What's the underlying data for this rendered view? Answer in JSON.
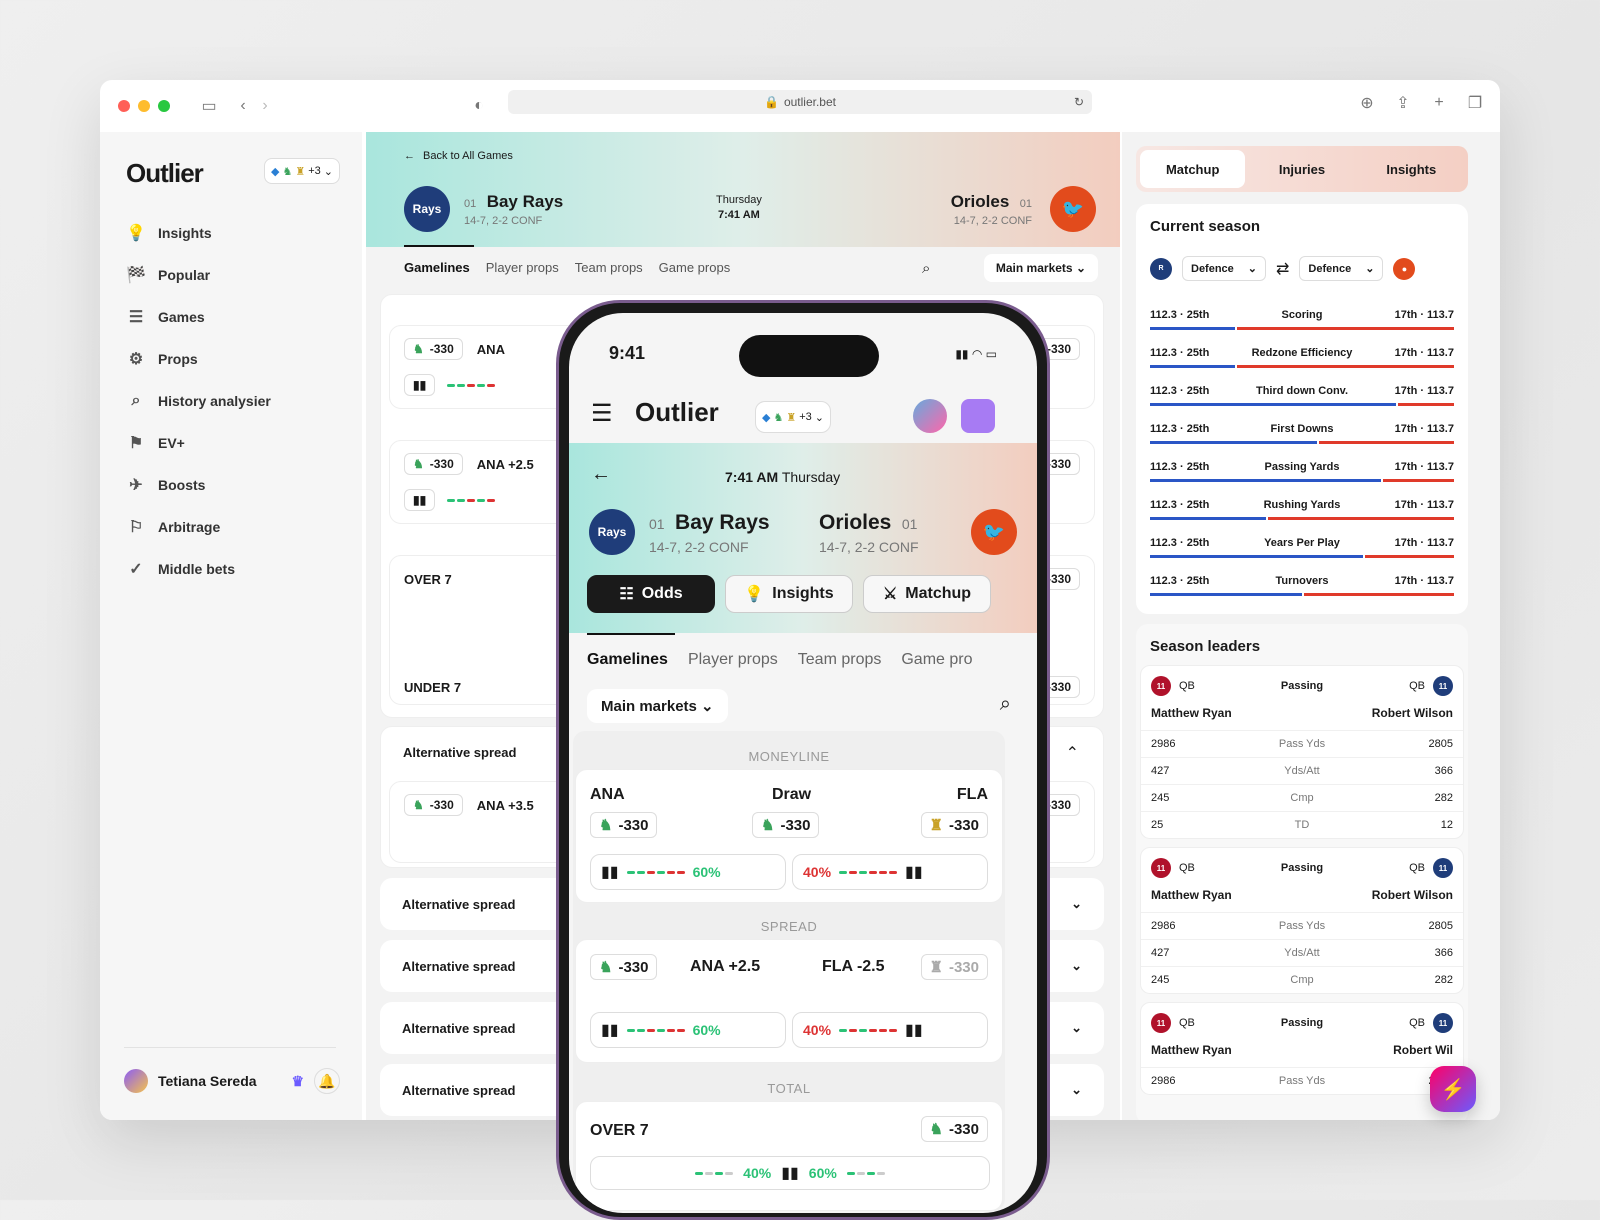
{
  "browser": {
    "url": "outlier.bet"
  },
  "app": {
    "logo": "Outlier",
    "chip_more": "+3"
  },
  "sidebar": {
    "items": [
      {
        "label": "Insights",
        "icon": "lightbulb-icon"
      },
      {
        "label": "Popular",
        "icon": "flame-icon"
      },
      {
        "label": "Games",
        "icon": "stack-icon"
      },
      {
        "label": "Props",
        "icon": "props-icon"
      },
      {
        "label": "History analysier",
        "icon": "history-icon"
      },
      {
        "label": "EV+",
        "icon": "ev-icon"
      },
      {
        "label": "Boosts",
        "icon": "rocket-icon"
      },
      {
        "label": "Arbitrage",
        "icon": "arbitrage-icon"
      },
      {
        "label": "Middle bets",
        "icon": "middle-icon"
      }
    ],
    "user": "Tetiana Sereda"
  },
  "game": {
    "back": "Back to All Games",
    "home": {
      "seed": "01",
      "name": "Bay Rays",
      "record": "14-7, 2-2 CONF",
      "logo": "Rays"
    },
    "away": {
      "seed": "01",
      "name": "Orioles",
      "record": "14-7, 2-2 CONF"
    },
    "day": "Thursday",
    "time": "7:41 AM"
  },
  "tabs": [
    "Gamelines",
    "Player props",
    "Team props",
    "Game props"
  ],
  "main_markets": "Main markets",
  "desktop_cards": {
    "odds": "-330",
    "ana": "ANA",
    "ana_spread": "ANA +2.5",
    "ana_spread2": "ANA +3.5",
    "over": "OVER 7",
    "under": "UNDER 7",
    "alt": "Alternative spread"
  },
  "right": {
    "tabs": [
      "Matchup",
      "Injuries",
      "Insights"
    ],
    "current_season": "Current season",
    "defence": "Defence",
    "stats": [
      {
        "label": "Scoring",
        "l": "112.3 · 25th",
        "r": "17th · 113.7",
        "p": 0.28
      },
      {
        "label": "Redzone Efficiency",
        "l": "112.3 · 25th",
        "r": "17th · 113.7",
        "p": 0.28
      },
      {
        "label": "Third down Conv.",
        "l": "112.3 · 25th",
        "r": "17th · 113.7",
        "p": 0.81
      },
      {
        "label": "First Downs",
        "l": "112.3 · 25th",
        "r": "17th · 113.7",
        "p": 0.55
      },
      {
        "label": "Passing Yards",
        "l": "112.3 · 25th",
        "r": "17th · 113.7",
        "p": 0.76
      },
      {
        "label": "Rushing Yards",
        "l": "112.3 · 25th",
        "r": "17th · 113.7",
        "p": 0.38
      },
      {
        "label": "Years Per Play",
        "l": "112.3 · 25th",
        "r": "17th · 113.7",
        "p": 0.7
      },
      {
        "label": "Turnovers",
        "l": "112.3 · 25th",
        "r": "17th · 113.7",
        "p": 0.5
      }
    ],
    "season_leaders": "Season leaders",
    "leaders": [
      {
        "pos": "QB",
        "cat": "Passing",
        "p1": "Matthew Ryan",
        "p2": "Robert Wilson",
        "rows": [
          [
            "2986",
            "Pass Yds",
            "2805"
          ],
          [
            "427",
            "Yds/Att",
            "366"
          ],
          [
            "245",
            "Cmp",
            "282"
          ],
          [
            "25",
            "TD",
            "12"
          ]
        ]
      },
      {
        "pos": "QB",
        "cat": "Passing",
        "p1": "Matthew Ryan",
        "p2": "Robert Wilson",
        "rows": [
          [
            "2986",
            "Pass Yds",
            "2805"
          ],
          [
            "427",
            "Yds/Att",
            "366"
          ],
          [
            "245",
            "Cmp",
            "282"
          ]
        ]
      },
      {
        "pos": "QB",
        "cat": "Passing",
        "p1": "Matthew Ryan",
        "p2": "Robert Wil",
        "rows": [
          [
            "2986",
            "Pass Yds",
            "2805"
          ]
        ]
      }
    ]
  },
  "phone": {
    "clock": "9:41",
    "time": "7:41 AM",
    "day": "Thursday",
    "tabs": [
      "Odds",
      "Insights",
      "Matchup"
    ],
    "gtabs": [
      "Gamelines",
      "Player props",
      "Team props",
      "Game pro"
    ],
    "moneyline": "MONEYLINE",
    "ml": {
      "ana": "ANA",
      "draw": "Draw",
      "fla": "FLA",
      "odds": "-330",
      "pct_l": "60%",
      "pct_r": "40%"
    },
    "spread": "SPREAD",
    "sp": {
      "ana": "ANA +2.5",
      "fla": "FLA -2.5",
      "odds": "-330",
      "pct_l": "60%",
      "pct_r": "40%"
    },
    "total": "TOTAL",
    "tot": {
      "over": "OVER 7",
      "odds": "-330",
      "pct_l": "40%",
      "pct_r": "60%"
    }
  }
}
